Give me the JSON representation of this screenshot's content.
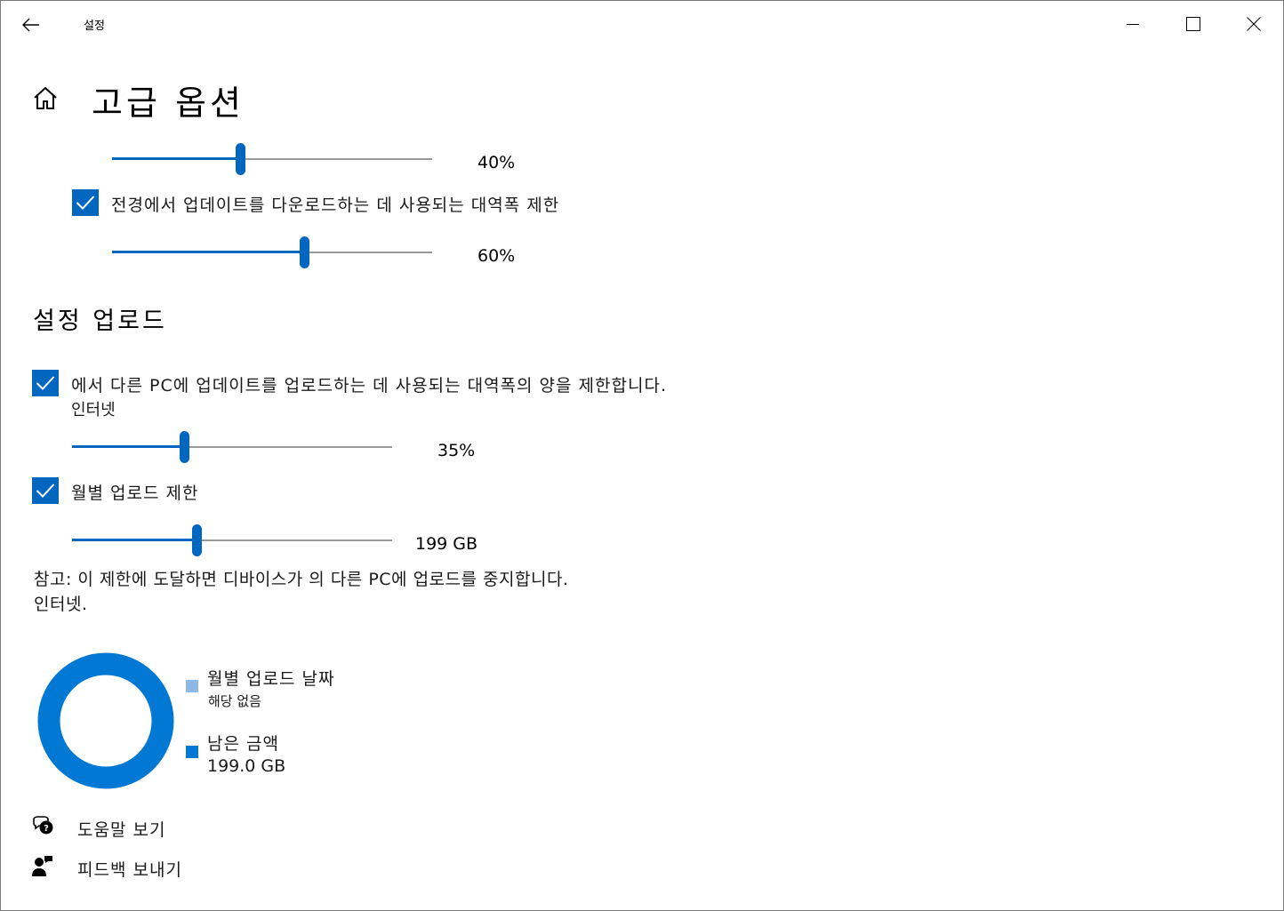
{
  "window": {
    "title": "설정",
    "back_icon": "back-arrow-icon",
    "minimize_icon": "minimize-icon",
    "maximize_icon": "maximize-icon",
    "close_icon": "close-icon"
  },
  "header": {
    "home_icon": "home-icon",
    "title": "고급 옵션"
  },
  "download": {
    "slider1": {
      "value_label": "40%",
      "percent": 40
    },
    "checkbox_label": "전경에서 업데이트를 다운로드하는 데 사용되는 대역폭 제한",
    "checked": true,
    "slider2": {
      "value_label": "60%",
      "percent": 60
    }
  },
  "upload": {
    "section_title": "설정 업로드",
    "bandwidth": {
      "checked": true,
      "label_line1": "에서 다른 PC에 업데이트를 업로드하는 데 사용되는 대역폭의 양을 제한합니다.",
      "label_line2": "인터넷",
      "slider": {
        "value_label": "35%",
        "percent": 35
      }
    },
    "monthly": {
      "checked": true,
      "label": "월별 업로드 제한",
      "slider": {
        "value_label": "199 GB",
        "percent": 39
      }
    },
    "note_line1": "참고: 이 제한에 도달하면 디바이스가 의 다른 PC에 업로드를 중지합니다.",
    "note_line2": "인터넷."
  },
  "usage": {
    "used_color": "#8ab9e8",
    "remaining_color": "#0078d4",
    "used_fraction": 0,
    "legend": [
      {
        "title": "월별 업로드 날짜",
        "value": "해당 없음"
      },
      {
        "title": "남은 금액",
        "value": "199.0 GB"
      }
    ]
  },
  "footer": {
    "help": {
      "label": "도움말 보기",
      "icon": "help-chat-icon"
    },
    "feedback": {
      "label": "피드백 보내기",
      "icon": "feedback-icon"
    }
  },
  "colors": {
    "accent": "#0067c0",
    "track": "#999999"
  }
}
